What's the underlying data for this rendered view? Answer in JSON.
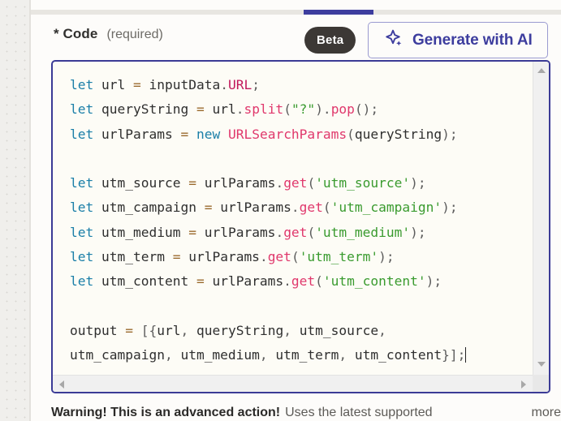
{
  "field": {
    "label": "* Code",
    "required_hint": "(required)"
  },
  "badges": {
    "beta": "Beta"
  },
  "buttons": {
    "generate_ai": "Generate with AI"
  },
  "icons": {
    "sparkle": "sparkle-icon",
    "scroll_up": "chevron-up-icon",
    "scroll_down": "chevron-down-icon",
    "scroll_left": "chevron-left-icon",
    "scroll_right": "chevron-right-icon"
  },
  "colors": {
    "accent_indigo": "#3d3d9e",
    "editor_border": "#3b3b96",
    "badge_dark": "#3c3835",
    "editor_bg": "#fdfcf6",
    "panel_bg": "#fdfcfa",
    "keyword_blue": "#1b7fa8",
    "string_green": "#3a9b2f",
    "function_pink": "#e0386c",
    "property_magenta": "#c2185b",
    "operator_brown": "#9a6a2e"
  },
  "code": {
    "language": "javascript",
    "lines": [
      "let url = inputData.URL;",
      "let queryString = url.split(\"?\").pop();",
      "let urlParams = new URLSearchParams(queryString);",
      "",
      "let utm_source = urlParams.get('utm_source');",
      "let utm_campaign = urlParams.get('utm_campaign');",
      "let utm_medium = urlParams.get('utm_medium');",
      "let utm_term = urlParams.get('utm_term');",
      "let utm_content = urlParams.get('utm_content');",
      "",
      "output = [{url, queryString, utm_source, utm_campaign, utm_medium, utm_term, utm_content}];"
    ]
  },
  "warning": {
    "strong": "Warning! This is an advanced action!",
    "rest": "Uses the latest supported",
    "more": "more"
  }
}
